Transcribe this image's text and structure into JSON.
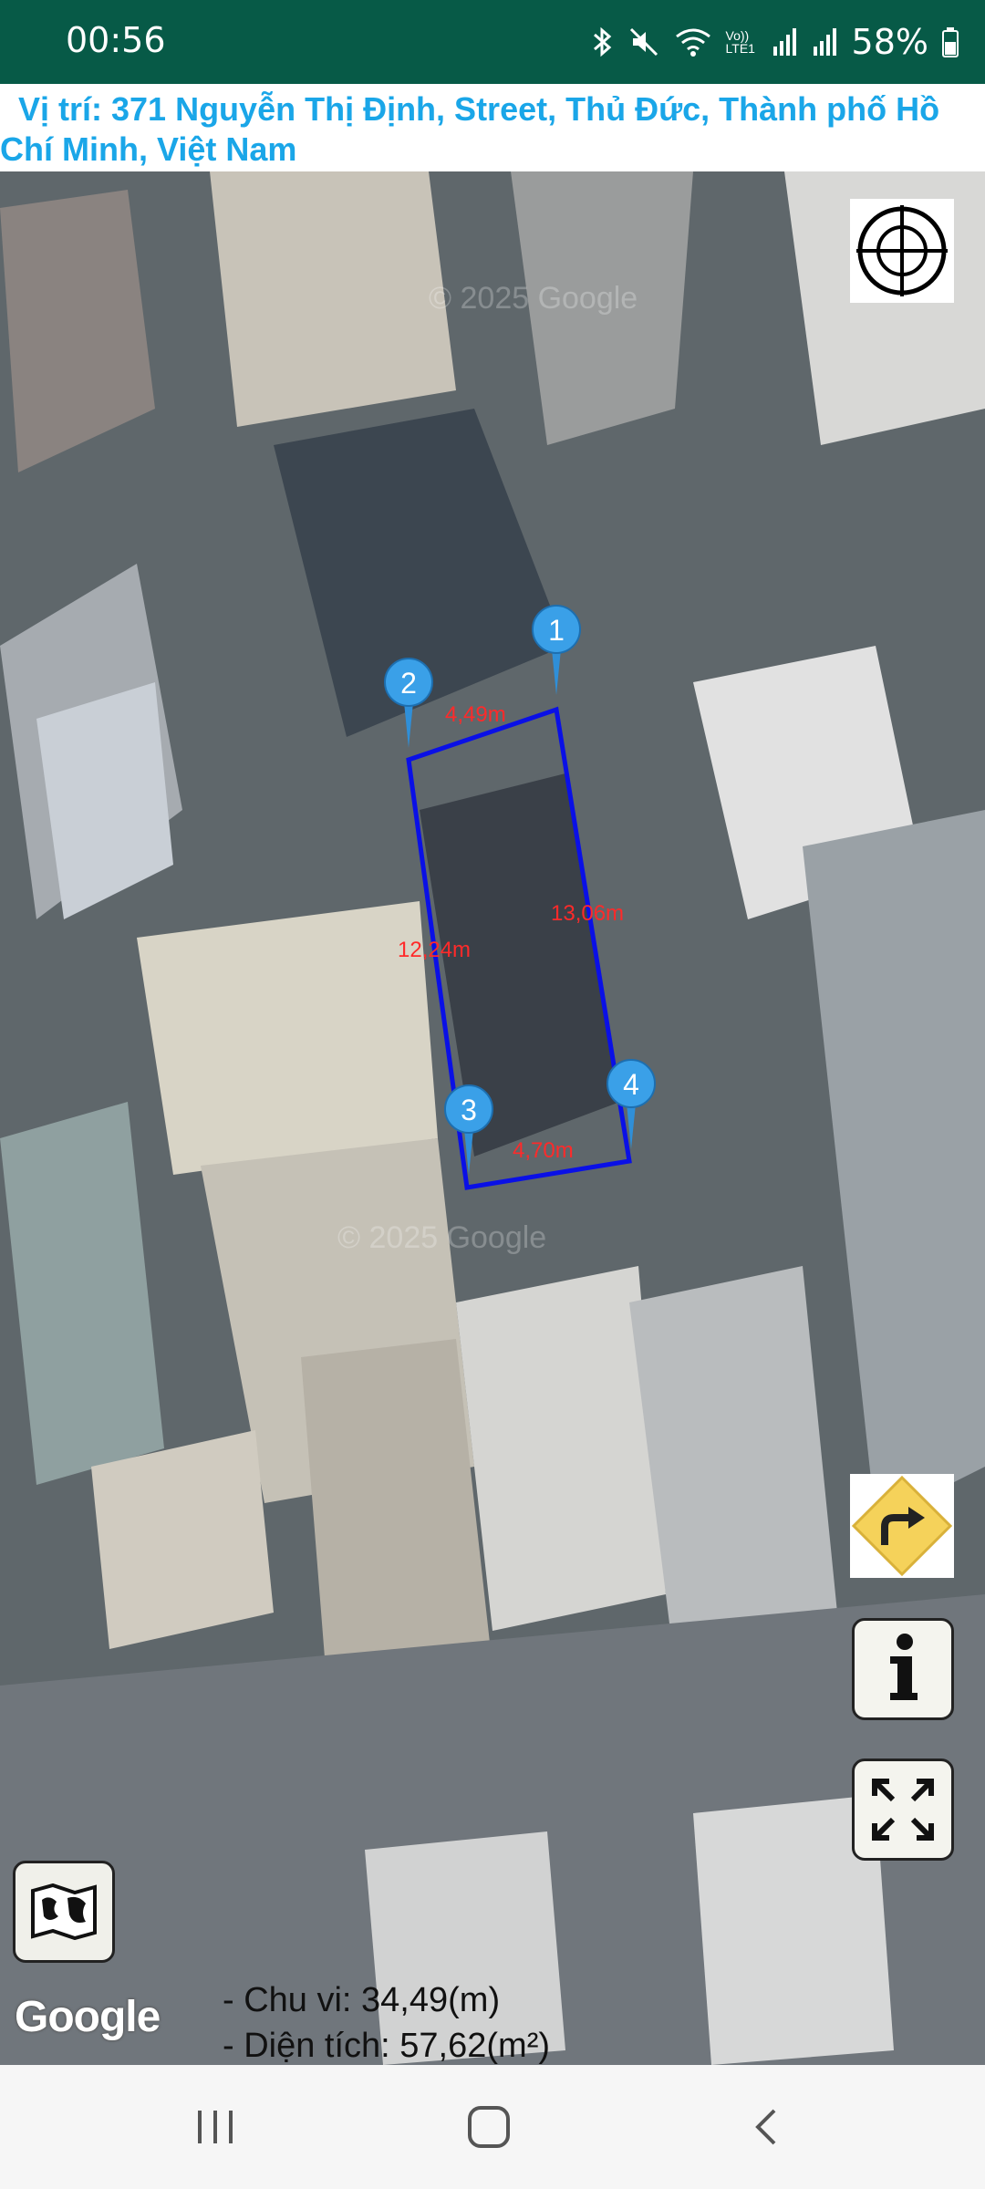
{
  "status_bar": {
    "time": "00:56",
    "battery": "58%",
    "network_label": "Vo)) LTE1",
    "icons": [
      "bluetooth-icon",
      "mute-icon",
      "wifi-icon",
      "volte-icon",
      "signal-icon",
      "signal-icon",
      "battery-icon"
    ]
  },
  "location": {
    "text": "Vị trí: 371 Nguyễn Thị Định, Street, Thủ Đức, Thành phố Hồ Chí Minh, Việt Nam",
    "color": "#1aa6e8"
  },
  "map": {
    "watermarks": [
      "© 2025 Google",
      "© 2025 Google"
    ],
    "polygon_color": "#0a10e6",
    "label_color": "#ff2a2a",
    "pins": [
      {
        "number": "1"
      },
      {
        "number": "2"
      },
      {
        "number": "3"
      },
      {
        "number": "4"
      }
    ],
    "segments": [
      {
        "label": "4,49m"
      },
      {
        "label": "13,06m"
      },
      {
        "label": "12,24m"
      },
      {
        "label": "4,70m"
      }
    ],
    "provider": "Google"
  },
  "stats": {
    "perimeter": "- Chu vi: 34,49(m)",
    "area": "- Diện tích: 57,62(m²)"
  },
  "buttons": {
    "locate": "target-icon",
    "directions": "turn-right-icon",
    "info": "info-icon",
    "fullscreen": "fullscreen-icon",
    "map_type": "map-icon"
  },
  "nav": {
    "recent": "recents-icon",
    "home": "home-icon",
    "back": "back-icon"
  },
  "colors": {
    "status_bar_bg": "#075a47",
    "nav_bg": "#f6f6f6"
  }
}
